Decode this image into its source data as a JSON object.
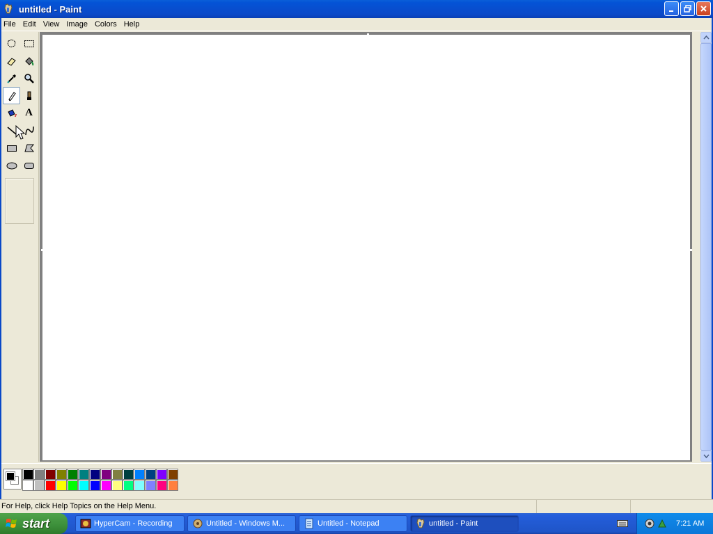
{
  "window": {
    "title": "untitled - Paint",
    "controls": {
      "minimize": "minimize-icon",
      "restore": "restore-icon",
      "close": "close-icon"
    }
  },
  "menu": [
    "File",
    "Edit",
    "View",
    "Image",
    "Colors",
    "Help"
  ],
  "tools": [
    {
      "name": "free-form-select",
      "icon": "free-form-select-icon"
    },
    {
      "name": "select",
      "icon": "rectangle-select-icon"
    },
    {
      "name": "eraser",
      "icon": "eraser-icon"
    },
    {
      "name": "fill-with-color",
      "icon": "paint-bucket-icon"
    },
    {
      "name": "pick-color",
      "icon": "eyedropper-icon"
    },
    {
      "name": "magnifier",
      "icon": "magnifier-icon"
    },
    {
      "name": "pencil",
      "icon": "pencil-icon",
      "selected": true
    },
    {
      "name": "brush",
      "icon": "brush-icon"
    },
    {
      "name": "airbrush",
      "icon": "airbrush-icon"
    },
    {
      "name": "text",
      "icon": "text-icon",
      "glyph": "A"
    },
    {
      "name": "line",
      "icon": "line-icon"
    },
    {
      "name": "curve",
      "icon": "curve-icon"
    },
    {
      "name": "rectangle",
      "icon": "rectangle-icon"
    },
    {
      "name": "polygon",
      "icon": "polygon-icon"
    },
    {
      "name": "ellipse",
      "icon": "ellipse-icon"
    },
    {
      "name": "rounded-rectangle",
      "icon": "rounded-rectangle-icon"
    }
  ],
  "colors": {
    "foreground": "#000000",
    "background": "#ffffff",
    "palette_top": [
      "#000000",
      "#808080",
      "#800000",
      "#808000",
      "#008000",
      "#008080",
      "#000080",
      "#800080",
      "#808040",
      "#004040",
      "#0080ff",
      "#004080",
      "#8000ff",
      "#804000"
    ],
    "palette_bottom": [
      "#ffffff",
      "#c0c0c0",
      "#ff0000",
      "#ffff00",
      "#00ff00",
      "#00ffff",
      "#0000ff",
      "#ff00ff",
      "#ffff80",
      "#00ff80",
      "#80ffff",
      "#8080ff",
      "#ff0080",
      "#ff8040"
    ]
  },
  "status": {
    "help_text": "For Help, click Help Topics on the Help Menu."
  },
  "taskbar": {
    "start_label": "start",
    "tasks": [
      {
        "label": "HyperCam - Recording",
        "icon": "hypercam-icon"
      },
      {
        "label": "Untitled - Windows M...",
        "icon": "windows-movie-maker-icon"
      },
      {
        "label": "Untitled - Notepad",
        "icon": "notepad-icon"
      },
      {
        "label": "untitled - Paint",
        "icon": "paint-icon",
        "active": true
      }
    ],
    "clock": "7:21 AM"
  }
}
